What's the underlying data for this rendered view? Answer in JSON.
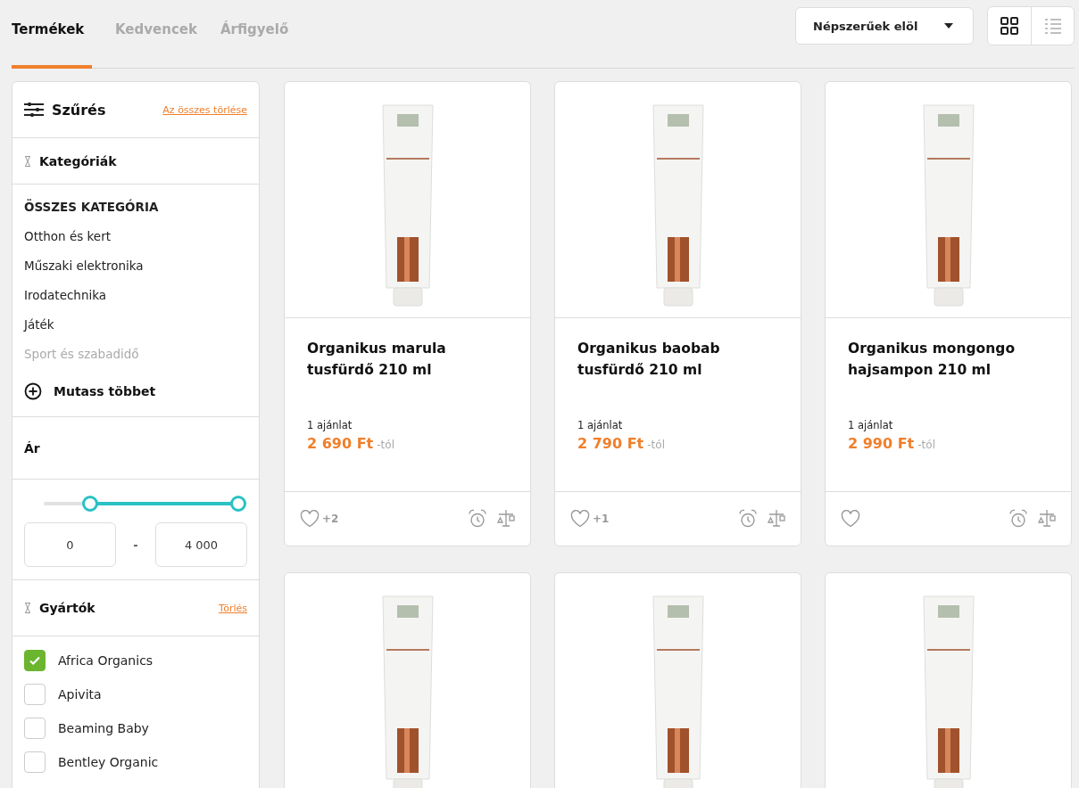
{
  "tabs": [
    {
      "label": "Termékek",
      "selected": true
    },
    {
      "label": "Kedvencek",
      "selected": false
    },
    {
      "label": "Árfigyelő",
      "selected": false
    }
  ],
  "sort": {
    "value": "Népszerűek elöl"
  },
  "view_toggle": [
    {
      "kind": "grid",
      "selected": true
    },
    {
      "kind": "list",
      "selected": false
    }
  ],
  "filters": {
    "title": "Szűrés",
    "clear_all": "Az összes törlése",
    "categories": {
      "title": "Kategóriák",
      "items": [
        {
          "label": "ÖSSZES KATEGÓRIA",
          "kind": "header",
          "faded": false
        },
        {
          "label": "Otthon és kert",
          "kind": "item",
          "faded": false
        },
        {
          "label": "Műszaki elektronika",
          "kind": "item",
          "faded": false
        },
        {
          "label": "Irodatechnika",
          "kind": "item",
          "faded": false
        },
        {
          "label": "Játék",
          "kind": "item",
          "faded": false
        },
        {
          "label": "Sport és szabadidő",
          "kind": "item",
          "faded": true
        }
      ],
      "show_more": "Mutass többet"
    },
    "price": {
      "title": "Ár",
      "thumbs": [
        {
          "level": 0.24
        },
        {
          "level": 1
        }
      ],
      "min": "0",
      "separator": "-",
      "max": "4 000"
    },
    "brands": {
      "title": "Gyártók",
      "clear": "Törlés",
      "items": [
        {
          "label": "Africa Organics",
          "checked": true
        },
        {
          "label": "Apivita",
          "checked": false
        },
        {
          "label": "Beaming Baby",
          "checked": false
        },
        {
          "label": "Bentley Organic",
          "checked": false
        }
      ]
    }
  },
  "products": [
    {
      "kind": "full",
      "name": "Organikus marula tusfürdő 210 ml",
      "offers": "1 ajánlat",
      "price": "2 690 Ft",
      "price_suffix": "-tól",
      "favorites": "+2"
    },
    {
      "kind": "full",
      "name": "Organikus baobab tusfürdő 210 ml",
      "offers": "1 ajánlat",
      "price": "2 790 Ft",
      "price_suffix": "-tól",
      "favorites": "+1"
    },
    {
      "kind": "full",
      "name": "Organikus mongongo hajsampon 210 ml",
      "offers": "1 ajánlat",
      "price": "2 990 Ft",
      "price_suffix": "-tól"
    },
    {
      "kind": "image_only"
    },
    {
      "kind": "image_only"
    },
    {
      "kind": "image_only"
    }
  ]
}
